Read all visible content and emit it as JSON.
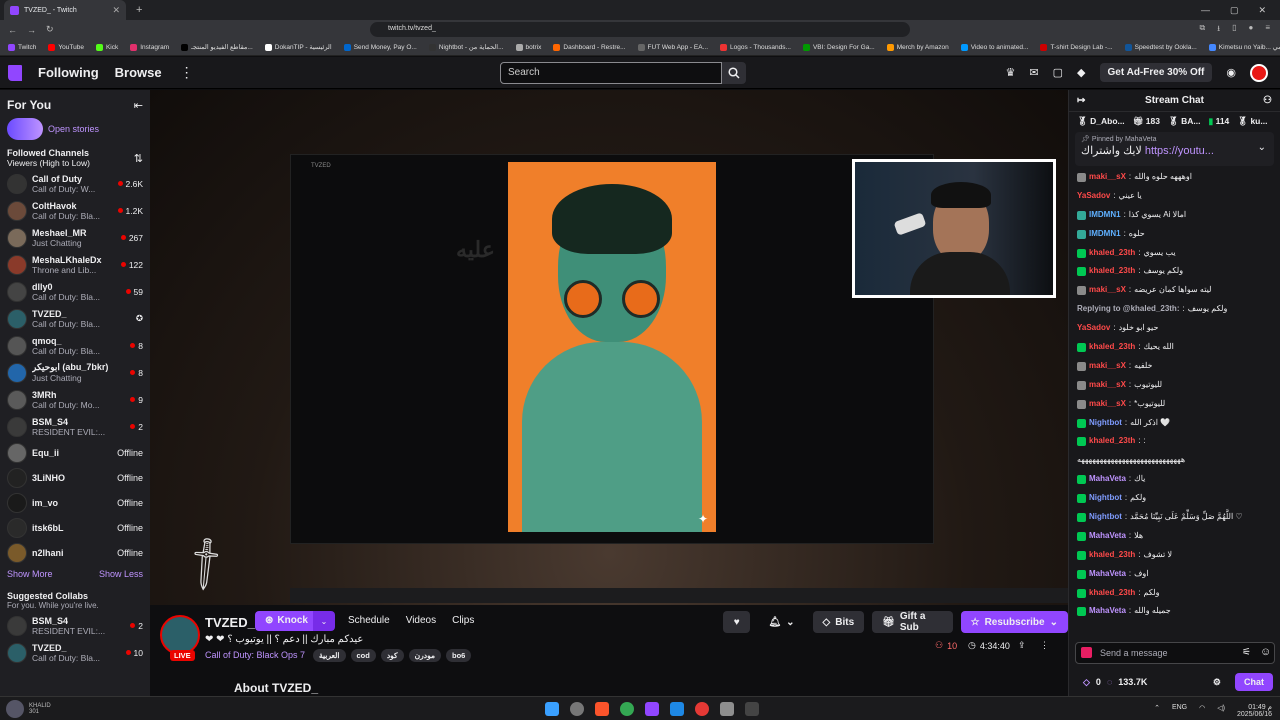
{
  "browser": {
    "tab_title": "TVZED_ - Twitch",
    "url": "twitch.tv/tvzed_",
    "bookmarks": [
      "Twitch",
      "YouTube",
      "Kick",
      "Instagram",
      "مقاطع الفيديو المنتجـ...",
      "DokanTIP - الرئيسية",
      "Send Money, Pay O...",
      "Nightbot - الحماية من...",
      "botrix",
      "Dashboard - Restre...",
      "FUT Web App - EA...",
      "Logos - Thousands...",
      "VBI: Design For Ga...",
      "Merch by Amazon",
      "Video to animated...",
      "T-shirt Design Lab -...",
      "Speedtest by Ookla...",
      "Kimetsu no Yaib... انمي"
    ]
  },
  "topnav": {
    "following": "Following",
    "browse": "Browse",
    "search_placeholder": "Search",
    "ad_free": "Get Ad-Free 30% Off",
    "notif_count": "1"
  },
  "sidebar": {
    "for_you": "For You",
    "open_stories": "Open stories",
    "followed_title": "Followed Channels",
    "followed_sort": "Viewers (High to Low)",
    "channels": [
      {
        "name": "Call of Duty",
        "game": "Call of Duty: W...",
        "viewers": "2.6K",
        "state": "live",
        "color": "#333333"
      },
      {
        "name": "ColtHavok",
        "game": "Call of Duty: Bla...",
        "viewers": "1.2K",
        "state": "live",
        "color": "#6b4a3a"
      },
      {
        "name": "Meshael_MR",
        "game": "Just Chatting",
        "viewers": "267",
        "state": "live",
        "color": "#7a6a5a"
      },
      {
        "name": "MeshaLKhaleDx",
        "game": "Throne and Lib...",
        "viewers": "122",
        "state": "live",
        "color": "#8a3a2a"
      },
      {
        "name": "dlly0",
        "game": "Call of Duty: Bla...",
        "viewers": "59",
        "state": "live",
        "color": "#444444"
      },
      {
        "name": "TVZED_",
        "game": "Call of Duty: Bla...",
        "viewers": "",
        "state": "none",
        "color": "#2b5f68"
      },
      {
        "name": "qmoq_",
        "game": "Call of Duty: Bla...",
        "viewers": "8",
        "state": "live",
        "color": "#555555"
      },
      {
        "name": "ابوحيكر (abu_7bkr)",
        "game": "Just Chatting",
        "viewers": "8",
        "state": "live",
        "color": "#2266aa"
      },
      {
        "name": "3MRh",
        "game": "Call of Duty: Mo...",
        "viewers": "9",
        "state": "live",
        "color": "#5a5a5a"
      },
      {
        "name": "BSM_S4",
        "game": "RESIDENT EVIL:...",
        "viewers": "2",
        "state": "live",
        "color": "#3a3a3a"
      },
      {
        "name": "Equ_ii",
        "game": "",
        "viewers": "Offline",
        "state": "off",
        "color": "#666666"
      },
      {
        "name": "3LiNHO",
        "game": "",
        "viewers": "Offline",
        "state": "off",
        "color": "#222222"
      },
      {
        "name": "im_vo",
        "game": "",
        "viewers": "Offline",
        "state": "off",
        "color": "#1a1a1a"
      },
      {
        "name": "itsk6bL",
        "game": "",
        "viewers": "Offline",
        "state": "off",
        "color": "#2a2a2a"
      },
      {
        "name": "n2lhani",
        "game": "",
        "viewers": "Offline",
        "state": "off",
        "color": "#7a5a2a"
      }
    ],
    "show_more": "Show More",
    "show_less": "Show Less",
    "suggested_title": "Suggested Collabs",
    "suggested_sub": "For you. While you're live.",
    "suggested": [
      {
        "name": "BSM_S4",
        "game": "RESIDENT EVIL:...",
        "viewers": "2",
        "color": "#3a3a3a"
      },
      {
        "name": "TVZED_",
        "game": "Call of Duty: Bla...",
        "viewers": "10",
        "color": "#2b5f68"
      }
    ],
    "overlay_name": "Pablo",
    "overlay_count": "4",
    "user_badge_name": "KHALID",
    "user_badge_num": "301"
  },
  "video": {
    "screen_channel": "TVZED",
    "screen_arabic": "عليه"
  },
  "stream": {
    "channel_name": "TVZED_",
    "live_label": "LIVE",
    "knock": "Knock",
    "tabs": [
      "Schedule",
      "Videos",
      "Clips"
    ],
    "title": "عيدكم مبارك || دعم ؟ || يوتيوب ؟ ❤ ❤",
    "game": "Call of Duty: Black Ops 7",
    "tags": [
      "العربية",
      "cod",
      "كود",
      "مودرن",
      "bo6"
    ],
    "bits": "Bits",
    "gift": "Gift a Sub",
    "resubscribe": "Resubscribe",
    "viewers": "10",
    "uptime": "4:34:40",
    "about": "About TVZED_"
  },
  "chat": {
    "header": "Stream Chat",
    "leaders": [
      {
        "name": "D_Abo...",
        "count": ""
      },
      {
        "name": "",
        "count": "183"
      },
      {
        "name": "BA...",
        "count": ""
      },
      {
        "name": "",
        "count": "114"
      },
      {
        "name": "ku...",
        "count": ""
      }
    ],
    "pinned_by": "Pinned by",
    "pinned_user": "MahaVeta",
    "pinned_text": "لايك واشتراك",
    "pinned_link": "https://youtu...",
    "messages": [
      {
        "user": "maki__sX",
        "text": "اوهههه حلوه والله",
        "color": "#ff4a4a",
        "badge": "#8a8a8a"
      },
      {
        "user": "YaSadov",
        "text": "يا عيني",
        "color": "#ff4a4a",
        "badge": ""
      },
      {
        "user": "IMDMN1",
        "text": "يسوي كذا Ai امالا",
        "color": "#5fb0ff",
        "badge": "#3a9"
      },
      {
        "user": "IMDMN1",
        "text": "حلوه",
        "color": "#5fb0ff",
        "badge": "#3a9"
      },
      {
        "user": "khaled_23th",
        "text": "يب يسوي",
        "color": "#ff4a4a",
        "badge": "#00c853"
      },
      {
        "user": "khaled_23th",
        "text": "ولكم يوسف",
        "color": "#ff4a4a",
        "badge": "#00c853"
      },
      {
        "user": "maki__sX",
        "text": "ليته سواها كمان عريضه",
        "color": "#ff4a4a",
        "badge": "#8a8a8a"
      },
      {
        "user": "Replying to @khaled_23th:",
        "text": "ولكم يوسف",
        "color": "#adadb8",
        "badge": ""
      },
      {
        "user": "YaSadov",
        "text": "حيو ابو خلود",
        "color": "#ff4a4a",
        "badge": ""
      },
      {
        "user": "khaled_23th",
        "text": "الله يحيك",
        "color": "#ff4a4a",
        "badge": "#00c853"
      },
      {
        "user": "maki__sX",
        "text": "خلفيه",
        "color": "#ff4a4a",
        "badge": "#8a8a8a"
      },
      {
        "user": "maki__sX",
        "text": "لليوتيوب",
        "color": "#ff4a4a",
        "badge": "#8a8a8a"
      },
      {
        "user": "maki__sX",
        "text": "*لليوتيوب",
        "color": "#ff4a4a",
        "badge": "#8a8a8a"
      },
      {
        "user": "Nightbot",
        "text": "اذكر الله 🤍",
        "color": "#7f9cff",
        "badge": "#00c853"
      },
      {
        "user": "khaled_23th",
        "text": ":",
        "color": "#ff4a4a",
        "badge": "#00c853"
      },
      {
        "user": "",
        "text": "ههههههههههههههههههههههههههههه",
        "color": "#efeff1",
        "badge": ""
      },
      {
        "user": "MahaVeta",
        "text": "ياك",
        "color": "#bf94ff",
        "badge": "#00c853"
      },
      {
        "user": "Nightbot",
        "text": "ولكم",
        "color": "#7f9cff",
        "badge": "#00c853"
      },
      {
        "user": "Nightbot",
        "text": "اللَّهُمَّ صَلِّ وَسَلِّمْ عَلَى نَبِيِّنَا مُحَمَّد ♡",
        "color": "#7f9cff",
        "badge": "#00c853"
      },
      {
        "user": "MahaVeta",
        "text": "هلا",
        "color": "#bf94ff",
        "badge": "#00c853"
      },
      {
        "user": "khaled_23th",
        "text": "لا تشوف",
        "color": "#ff4a4a",
        "badge": "#00c853"
      },
      {
        "user": "MahaVeta",
        "text": "اوف",
        "color": "#bf94ff",
        "badge": "#00c853"
      },
      {
        "user": "khaled_23th",
        "text": "ولكم",
        "color": "#ff4a4a",
        "badge": "#00c853"
      },
      {
        "user": "MahaVeta",
        "text": "جميله والله",
        "color": "#bf94ff",
        "badge": "#00c853"
      }
    ],
    "input_placeholder": "Send a message",
    "bits_count": "0",
    "points": "133.7K",
    "chat_button": "Chat"
  },
  "taskbar": {
    "lang": "ENG",
    "time": "01:49 م",
    "date": "2025/06/16"
  }
}
